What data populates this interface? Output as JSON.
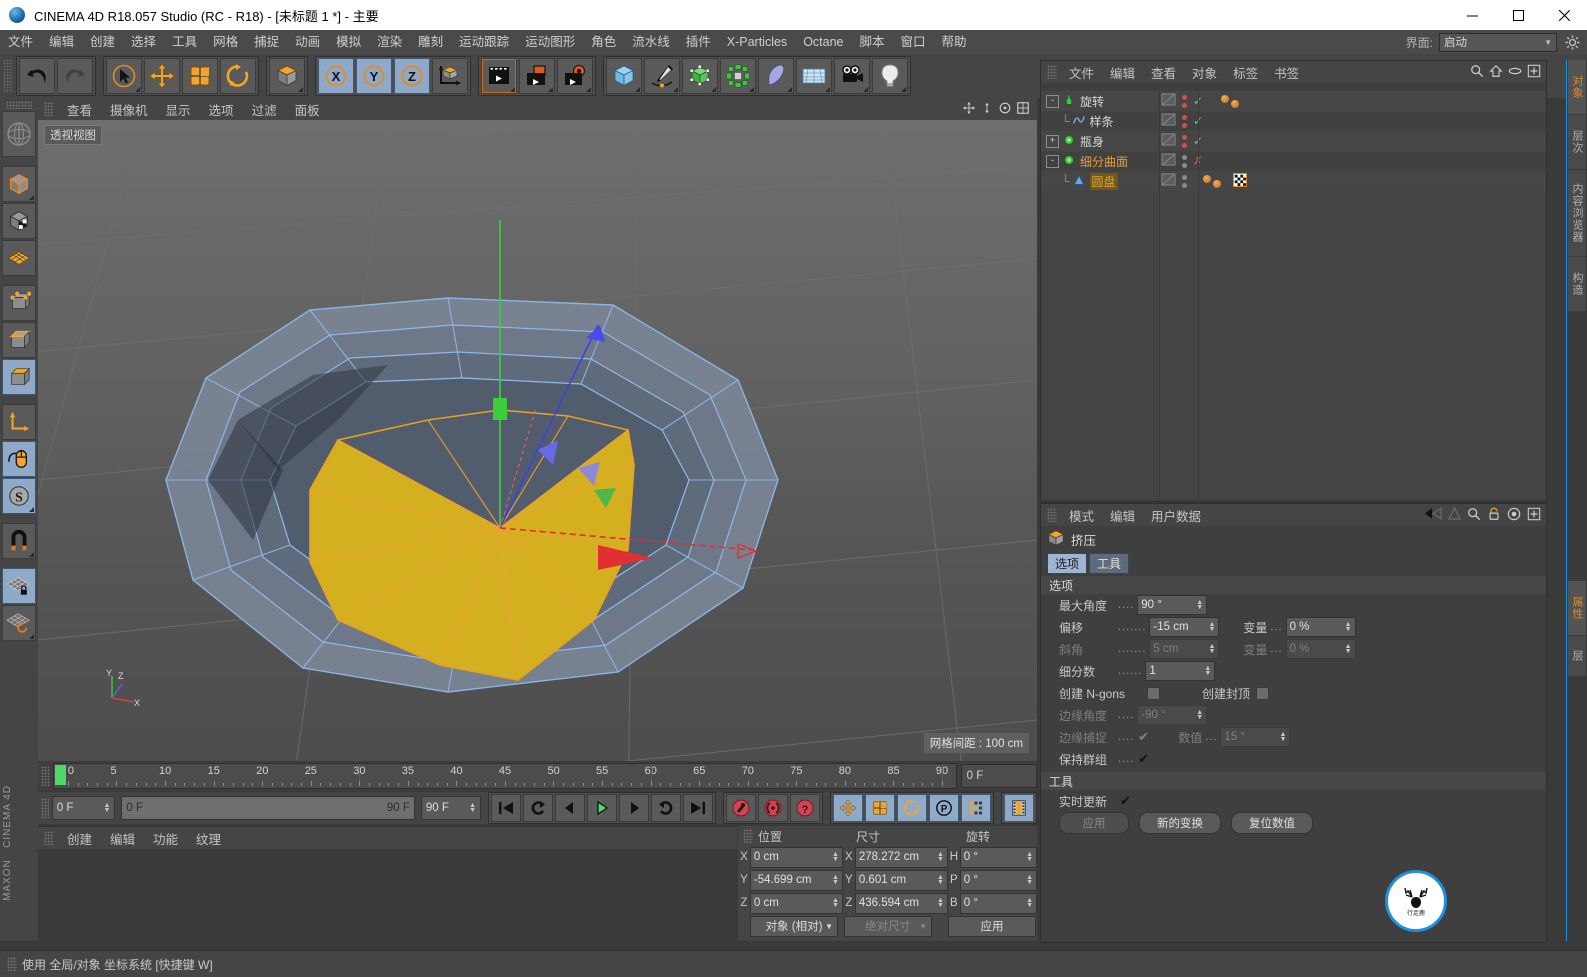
{
  "titlebar": {
    "title": "CINEMA 4D R18.057 Studio (RC - R18) - [未标题 1 *] - 主要",
    "minimize": "–",
    "maximize": "❐",
    "close": "✕"
  },
  "menubar": {
    "items": [
      "文件",
      "编辑",
      "创建",
      "选择",
      "工具",
      "网格",
      "捕捉",
      "动画",
      "模拟",
      "渲染",
      "雕刻",
      "运动跟踪",
      "运动图形",
      "角色",
      "流水线",
      "插件",
      "X-Particles",
      "Octane",
      "脚本",
      "窗口",
      "帮助"
    ],
    "layout_label": "界面:",
    "layout_value": "启动"
  },
  "toolbar": {
    "groups": [
      {
        "name": "history",
        "buttons": [
          {
            "name": "undo-button",
            "icon": "undo"
          },
          {
            "name": "redo-button",
            "icon": "redo",
            "dim": true
          }
        ]
      },
      {
        "name": "transform",
        "buttons": [
          {
            "name": "select-tool-button",
            "icon": "cursor"
          },
          {
            "name": "move-tool-button",
            "icon": "move"
          },
          {
            "name": "scale-tool-button",
            "icon": "scale"
          },
          {
            "name": "rotate-tool-button",
            "icon": "rotate"
          }
        ]
      },
      {
        "name": "world-coord",
        "buttons": [
          {
            "name": "world-object-axis-button",
            "icon": "cube"
          }
        ]
      },
      {
        "name": "axis-lock",
        "buttons": [
          {
            "name": "lock-x-button",
            "icon": "X",
            "on": true
          },
          {
            "name": "lock-y-button",
            "icon": "Y",
            "on": true
          },
          {
            "name": "lock-z-button",
            "icon": "Z",
            "on": true
          },
          {
            "name": "coordinate-system-button",
            "icon": "axis-cube"
          }
        ]
      },
      {
        "name": "render",
        "buttons": [
          {
            "name": "render-view-button",
            "icon": "clapper"
          },
          {
            "name": "render-to-picture-viewer-button",
            "icon": "clapper-pv"
          },
          {
            "name": "render-settings-button",
            "icon": "clapper-gear"
          }
        ]
      },
      {
        "name": "creation",
        "buttons": [
          {
            "name": "add-cube-button",
            "icon": "cube-blue"
          },
          {
            "name": "add-spline-button",
            "icon": "pen"
          },
          {
            "name": "add-generator-button",
            "icon": "nurbs"
          },
          {
            "name": "add-mograph-button",
            "icon": "mograph"
          },
          {
            "name": "add-deformer-button",
            "icon": "bend"
          },
          {
            "name": "add-environment-button",
            "icon": "floor"
          },
          {
            "name": "add-camera-button",
            "icon": "camera"
          },
          {
            "name": "add-light-button",
            "icon": "light"
          }
        ]
      }
    ]
  },
  "left_toolbar": {
    "items": [
      {
        "name": "viewport-axis-widget",
        "icon": "globe"
      },
      {
        "name": "model-mode-button",
        "icon": "model-cube"
      },
      {
        "name": "texture-mode-button",
        "icon": "texture-cube"
      },
      {
        "name": "workplane-mode-button",
        "icon": "workplane"
      },
      {
        "name": "point-mode-button",
        "icon": "points"
      },
      {
        "name": "edge-mode-button",
        "icon": "edges"
      },
      {
        "name": "polygon-mode-button",
        "icon": "polygons",
        "on": true
      },
      {
        "name": "object-axis-button",
        "icon": "axis"
      },
      {
        "name": "enable-axis-button",
        "icon": "mouse",
        "on": true
      },
      {
        "name": "soft-selection-button",
        "icon": "soft-s",
        "on": true
      },
      {
        "name": "snap-button",
        "icon": "magnet"
      },
      {
        "name": "workplane-lock-button",
        "icon": "plane-lock",
        "on": true
      },
      {
        "name": "workplane-rotate-button",
        "icon": "plane-rotate"
      }
    ],
    "brand_top": "MAXON",
    "brand_bottom": "CINEMA 4D"
  },
  "viewport": {
    "menu": [
      "查看",
      "摄像机",
      "显示",
      "选项",
      "过滤",
      "面板"
    ],
    "label": "透视视图",
    "grid_note": "网格间距 : 100 cm",
    "axis_letters": {
      "x": "X",
      "y": "Y",
      "z": "Z"
    }
  },
  "timeline": {
    "ticks": [
      "0",
      "5",
      "10",
      "15",
      "20",
      "25",
      "30",
      "35",
      "40",
      "45",
      "50",
      "55",
      "60",
      "65",
      "70",
      "75",
      "80",
      "85",
      "90"
    ],
    "current_frame_field": "0 F",
    "start_field": "0 F",
    "slider_left": "0 F",
    "slider_right": "90 F",
    "end_field": "90 F",
    "transport": [
      {
        "name": "goto-start-button",
        "icon": "skip-back"
      },
      {
        "name": "play-reverse-loop-button",
        "icon": "loop-left"
      },
      {
        "name": "step-back-button",
        "icon": "prev-frame"
      },
      {
        "name": "play-button",
        "icon": "play"
      },
      {
        "name": "step-forward-button",
        "icon": "next-frame"
      },
      {
        "name": "loop-button",
        "icon": "loop-right"
      },
      {
        "name": "goto-end-button",
        "icon": "skip-forward"
      },
      {
        "name": "record-active-objects-button",
        "icon": "record-key"
      },
      {
        "name": "autokeying-button",
        "icon": "auto-key"
      },
      {
        "name": "keyframe-selection-button",
        "icon": "key-question"
      },
      {
        "name": "record-position-button",
        "icon": "pos-key",
        "on": true
      },
      {
        "name": "record-scale-button",
        "icon": "scale-key",
        "on": true
      },
      {
        "name": "record-rotation-button",
        "icon": "rot-key",
        "on": true
      },
      {
        "name": "record-pla-button",
        "icon": "pla-key",
        "on": true
      },
      {
        "name": "record-parameter-button",
        "icon": "param-key",
        "on": true
      },
      {
        "name": "timeline-button",
        "icon": "film"
      }
    ]
  },
  "material_manager": {
    "menu": [
      "创建",
      "编辑",
      "功能",
      "纹理"
    ]
  },
  "coordinates": {
    "headers": {
      "position": "位置",
      "size": "尺寸",
      "rotation": "旋转"
    },
    "rows": [
      {
        "axis": "X",
        "position": "0 cm",
        "size": "278.272 cm",
        "rot_axis": "H",
        "rotation": "0 °"
      },
      {
        "axis": "Y",
        "position": "-54.699 cm",
        "size": "0.601 cm",
        "rot_axis": "P",
        "rotation": "0 °"
      },
      {
        "axis": "Z",
        "position": "0 cm",
        "size": "436.594 cm",
        "rot_axis": "B",
        "rotation": "0 °"
      }
    ],
    "mode_select": "对象 (相对)",
    "size_select": "绝对尺寸",
    "apply_button": "应用"
  },
  "object_manager": {
    "menu": [
      "文件",
      "编辑",
      "查看",
      "对象",
      "标签",
      "书签"
    ],
    "objects": [
      {
        "name": "旋转",
        "indent": 0,
        "icon": "lathe",
        "expander": "-",
        "color": "#d7d7d7",
        "visdots": true,
        "check": "✓",
        "tags": [
          "dot-orange",
          "dot-orange"
        ]
      },
      {
        "name": "样条",
        "indent": 1,
        "icon": "spline",
        "expander": "",
        "color": "#d7d7d7",
        "visdots": true,
        "check": "✓",
        "tags": []
      },
      {
        "name": "瓶身",
        "indent": 0,
        "icon": "generator",
        "expander": "+",
        "color": "#d7d7d7",
        "visdots": true,
        "check": "✓",
        "tags": []
      },
      {
        "name": "细分曲面",
        "indent": 0,
        "icon": "generator",
        "expander": "-",
        "color": "#e0a03a",
        "visdots": true,
        "check": "✗",
        "tags": []
      },
      {
        "name": "圆盘",
        "indent": 1,
        "icon": "disc",
        "expander": "",
        "color": "#e0a03a",
        "visdots": false,
        "check": "",
        "tags": [
          "dot-orange",
          "dot-orange",
          "checker"
        ]
      }
    ]
  },
  "attribute_manager": {
    "menu": [
      "模式",
      "编辑",
      "用户数据"
    ],
    "object_title": "挤压",
    "tabs": [
      {
        "label": "选项",
        "selected": true
      },
      {
        "label": "工具",
        "selected": false
      }
    ],
    "sections": [
      {
        "title": "选项",
        "rows": [
          {
            "label": "最大角度",
            "dots": "....",
            "value": "90 °",
            "type": "field",
            "disabled": false
          },
          {
            "label": "偏移",
            "dots": ".......",
            "value": "-15 cm",
            "type": "field",
            "disabled": false,
            "label2": "变量",
            "dots2": "...",
            "value2": "0 %",
            "disabled2": false
          },
          {
            "label": "斜角",
            "dots": ".......",
            "value": "5 cm",
            "type": "field",
            "disabled": true,
            "label2": "变量",
            "dots2": "...",
            "value2": "0 %",
            "disabled2": true
          },
          {
            "label": "细分数",
            "dots": "......",
            "value": "1",
            "type": "field",
            "disabled": false
          },
          {
            "label": "创建 N-gons",
            "dots": "",
            "value": "",
            "type": "checkbox",
            "checked": false,
            "label2": "创建封顶",
            "value2": "",
            "type2": "checkbox",
            "checked2": false
          },
          {
            "label": "边缘角度",
            "dots": "....",
            "value": "-90 °",
            "type": "field",
            "disabled": true
          },
          {
            "label": "边缘捕捉",
            "dots": "....",
            "value": "",
            "type": "checkmark",
            "checked": true,
            "disabled": true,
            "label2": "数值",
            "dots2": "...",
            "value2": "15 °",
            "disabled2": true
          },
          {
            "label": "保持群组",
            "dots": "....",
            "value": "",
            "type": "checkmark",
            "checked": true,
            "disabled": false
          }
        ]
      },
      {
        "title": "工具",
        "rows": [
          {
            "label": "实时更新",
            "dots": "",
            "value": "",
            "type": "checkmark",
            "checked": true,
            "disabled": false
          }
        ],
        "buttons": [
          {
            "label": "应用",
            "disabled": true
          },
          {
            "label": "新的变换",
            "disabled": false
          },
          {
            "label": "复位数值",
            "disabled": false
          }
        ]
      }
    ]
  },
  "dock_tabs_top": [
    "对象",
    "层次",
    "内容浏览器",
    "构造"
  ],
  "dock_tabs_bottom": [
    "属性",
    "层"
  ],
  "status": {
    "text": "使用 全局/对象 坐标系统 [快捷键 W]"
  },
  "watermark": {
    "sub": "行走鹿"
  },
  "colors": {
    "accent_orange": "#e08a2a",
    "selection_blue": "#8fa9c8",
    "highlight_blue": "#1f8fe0",
    "panel_bg": "#3f3f3f",
    "toolbar_bg": "#454545",
    "mesh_yellow": "#d4b021",
    "wire_blue": "#8fb8e8"
  }
}
